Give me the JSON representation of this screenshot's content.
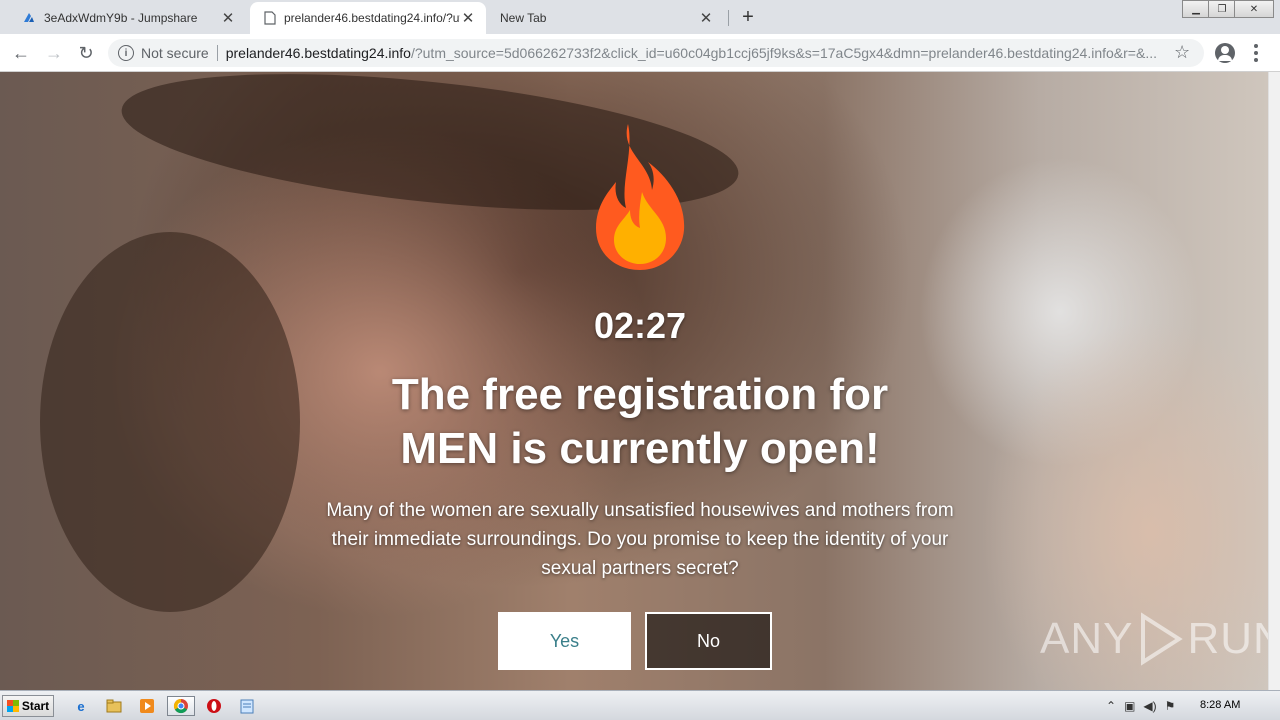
{
  "browser": {
    "tabs": [
      {
        "title": "3eAdxWdmY9b - Jumpshare",
        "active": false,
        "icon": "jumpshare-icon"
      },
      {
        "title": "prelander46.bestdating24.info/?utm",
        "active": true,
        "icon": "page-icon"
      },
      {
        "title": "New Tab",
        "active": false,
        "icon": ""
      }
    ],
    "security_label": "Not secure",
    "url_host": "prelander46.bestdating24.info",
    "url_path": "/?utm_source=5d066262733f2&click_id=u60c04gb1ccj65jf9ks&s=17aC5gx4&dmn=prelander46.bestdating24.info&r=&..."
  },
  "page": {
    "timer": "02:27",
    "headline": "The free registration for MEN is currently open!",
    "description": "Many of the women are sexually unsatisfied housewives and mothers from their immediate surroundings. Do you promise to keep the identity of your sexual partners secret?",
    "yes_label": "Yes",
    "no_label": "No",
    "watermark_left": "ANY",
    "watermark_right": "RUN",
    "colors": {
      "yes_text": "#3a7f8a",
      "flame_outer": "#ff5a1f",
      "flame_inner": "#ffb000"
    }
  },
  "taskbar": {
    "start_label": "Start",
    "clock": "8:28 AM",
    "icons": [
      "ie-icon",
      "explorer-icon",
      "media-player-icon",
      "chrome-icon",
      "opera-icon",
      "notepad-icon"
    ]
  }
}
